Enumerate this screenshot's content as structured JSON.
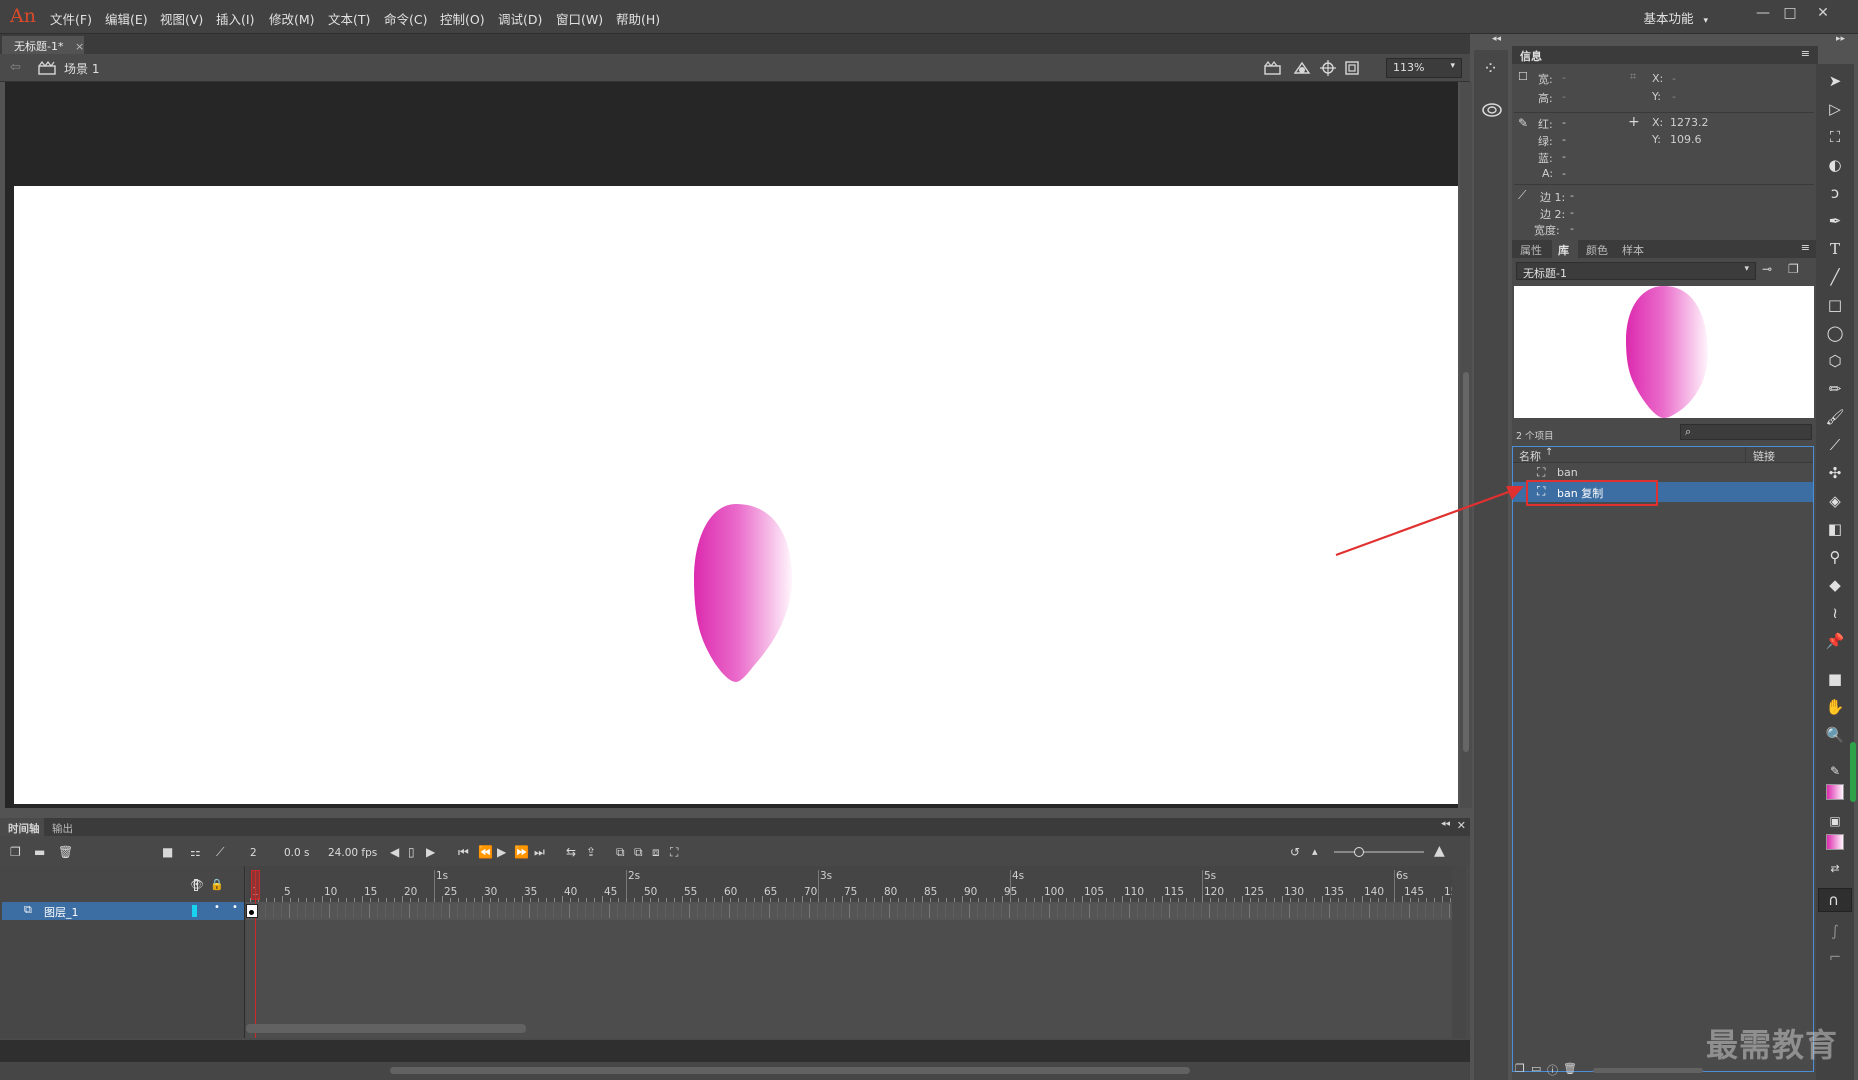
{
  "app": {
    "logo": "An",
    "menu": [
      "文件(F)",
      "编辑(E)",
      "视图(V)",
      "插入(I)",
      "修改(M)",
      "文本(T)",
      "命令(C)",
      "控制(O)",
      "调试(D)",
      "窗口(W)",
      "帮助(H)"
    ],
    "workspace": "基本功能",
    "window_controls": [
      "—",
      "□",
      "✕"
    ]
  },
  "document": {
    "tab_label": "无标题-1*",
    "tab_close": "×",
    "scene_label": "场景 1",
    "zoom": "113%"
  },
  "info_panel": {
    "title": "信息",
    "width_label": "宽:",
    "width_value": "-",
    "height_label": "高:",
    "height_value": "-",
    "x_label": "X:",
    "x_value": "-",
    "y_label": "Y:",
    "y_value": "-",
    "red_label": "红:",
    "red_value": "-",
    "green_label": "绿:",
    "green_value": "-",
    "blue_label": "蓝:",
    "blue_value": "-",
    "alpha_label": "A:",
    "alpha_value": "-",
    "cursor_x_label": "X:",
    "cursor_x_value": "1273.2",
    "cursor_y_label": "Y:",
    "cursor_y_value": "109.6",
    "edge1_label": "边 1:",
    "edge1_value": "-",
    "edge2_label": "边 2:",
    "edge2_value": "-",
    "stroke_width_label": "宽度:",
    "stroke_width_value": "-"
  },
  "library_panel": {
    "tabs": [
      "属性",
      "库",
      "颜色",
      "样本"
    ],
    "active_tab": "库",
    "document_select": "无标题-1",
    "item_count": "2 个项目",
    "col_name": "名称",
    "col_linkage": "链接",
    "items": [
      {
        "name": "ban"
      },
      {
        "name": "ban 复制"
      }
    ]
  },
  "timeline": {
    "tabs": [
      "时间轴",
      "输出"
    ],
    "current_frame": "2",
    "elapsed": "0.0 s",
    "fps": "24.00 fps",
    "layer_name": "图层_1",
    "second_labels": [
      "1s",
      "2s",
      "3s",
      "4s",
      "5s",
      "6s"
    ],
    "frame_ticks": [
      "1",
      "5",
      "10",
      "15",
      "20",
      "25",
      "30",
      "35",
      "40",
      "45",
      "50",
      "55",
      "60",
      "65",
      "70",
      "75",
      "80",
      "85",
      "90",
      "95",
      "100",
      "105",
      "110",
      "115",
      "120",
      "125",
      "130",
      "135",
      "140",
      "145",
      "15"
    ]
  },
  "watermark": "最需教育",
  "colors": {
    "petal_pink": "#e03bb6",
    "selection_blue": "#3c6ea3",
    "annotation_red": "#e03030"
  }
}
